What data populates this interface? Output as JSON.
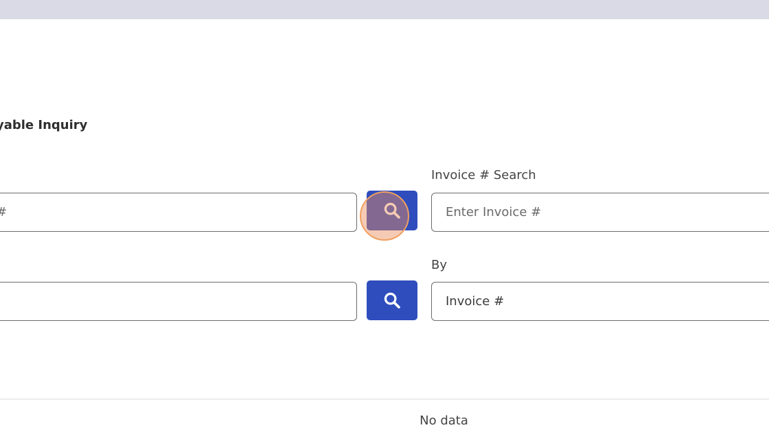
{
  "page": {
    "title": "yable Inquiry"
  },
  "search": {
    "left_placeholder": "#",
    "invoice_label": "Invoice # Search",
    "invoice_placeholder": "Enter Invoice #",
    "by_label": "By",
    "by_value": "Invoice #"
  },
  "icons": {
    "search": "search-icon"
  },
  "colors": {
    "accent": "#2f4dbd",
    "topbar": "#d9dae6",
    "click_indicator": "#f0a060"
  },
  "results": {
    "empty_text": "No data"
  }
}
